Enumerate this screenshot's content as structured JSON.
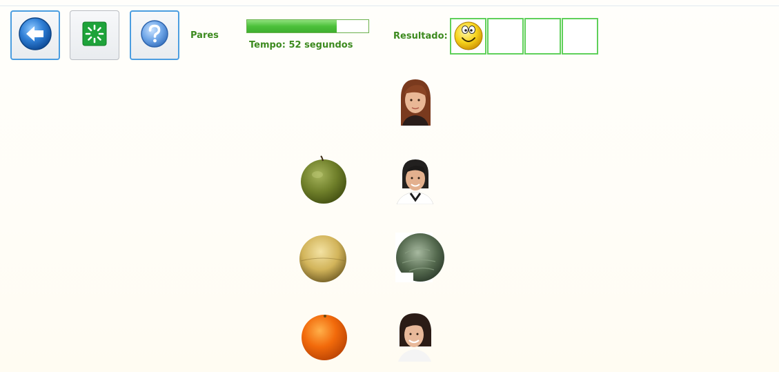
{
  "toolbar": {
    "buttons": [
      {
        "name": "back",
        "icon": "arrow-left-icon"
      },
      {
        "name": "restart",
        "icon": "loading-spinner-icon"
      },
      {
        "name": "help",
        "icon": "question-mark-icon"
      }
    ]
  },
  "game": {
    "title": "Pares",
    "timer_text": "Tempo: 52 segundos",
    "time_remaining_fraction": 0.74,
    "result_label": "Resultado:",
    "result_slots": [
      {
        "state": "smiley",
        "icon": "smiley-face-icon"
      },
      {
        "state": "empty"
      },
      {
        "state": "empty"
      },
      {
        "state": "empty"
      }
    ]
  },
  "board": {
    "left_column": [
      {
        "item": "empty"
      },
      {
        "item": "green-apple",
        "icon": "green-apple-icon"
      },
      {
        "item": "yellow-melon",
        "icon": "melon-icon"
      },
      {
        "item": "orange",
        "icon": "orange-fruit-icon"
      }
    ],
    "right_column": [
      {
        "item": "woman-red-hair",
        "icon": "woman-portrait-icon"
      },
      {
        "item": "woman-dark-hair",
        "icon": "woman-portrait-icon"
      },
      {
        "item": "cabbage",
        "icon": "cabbage-icon"
      },
      {
        "item": "woman-smiling",
        "icon": "woman-portrait-icon"
      }
    ]
  },
  "colors": {
    "accent_green": "#3c8a1f",
    "slot_border": "#5fd05a",
    "button_active_border": "#4a9de0"
  }
}
